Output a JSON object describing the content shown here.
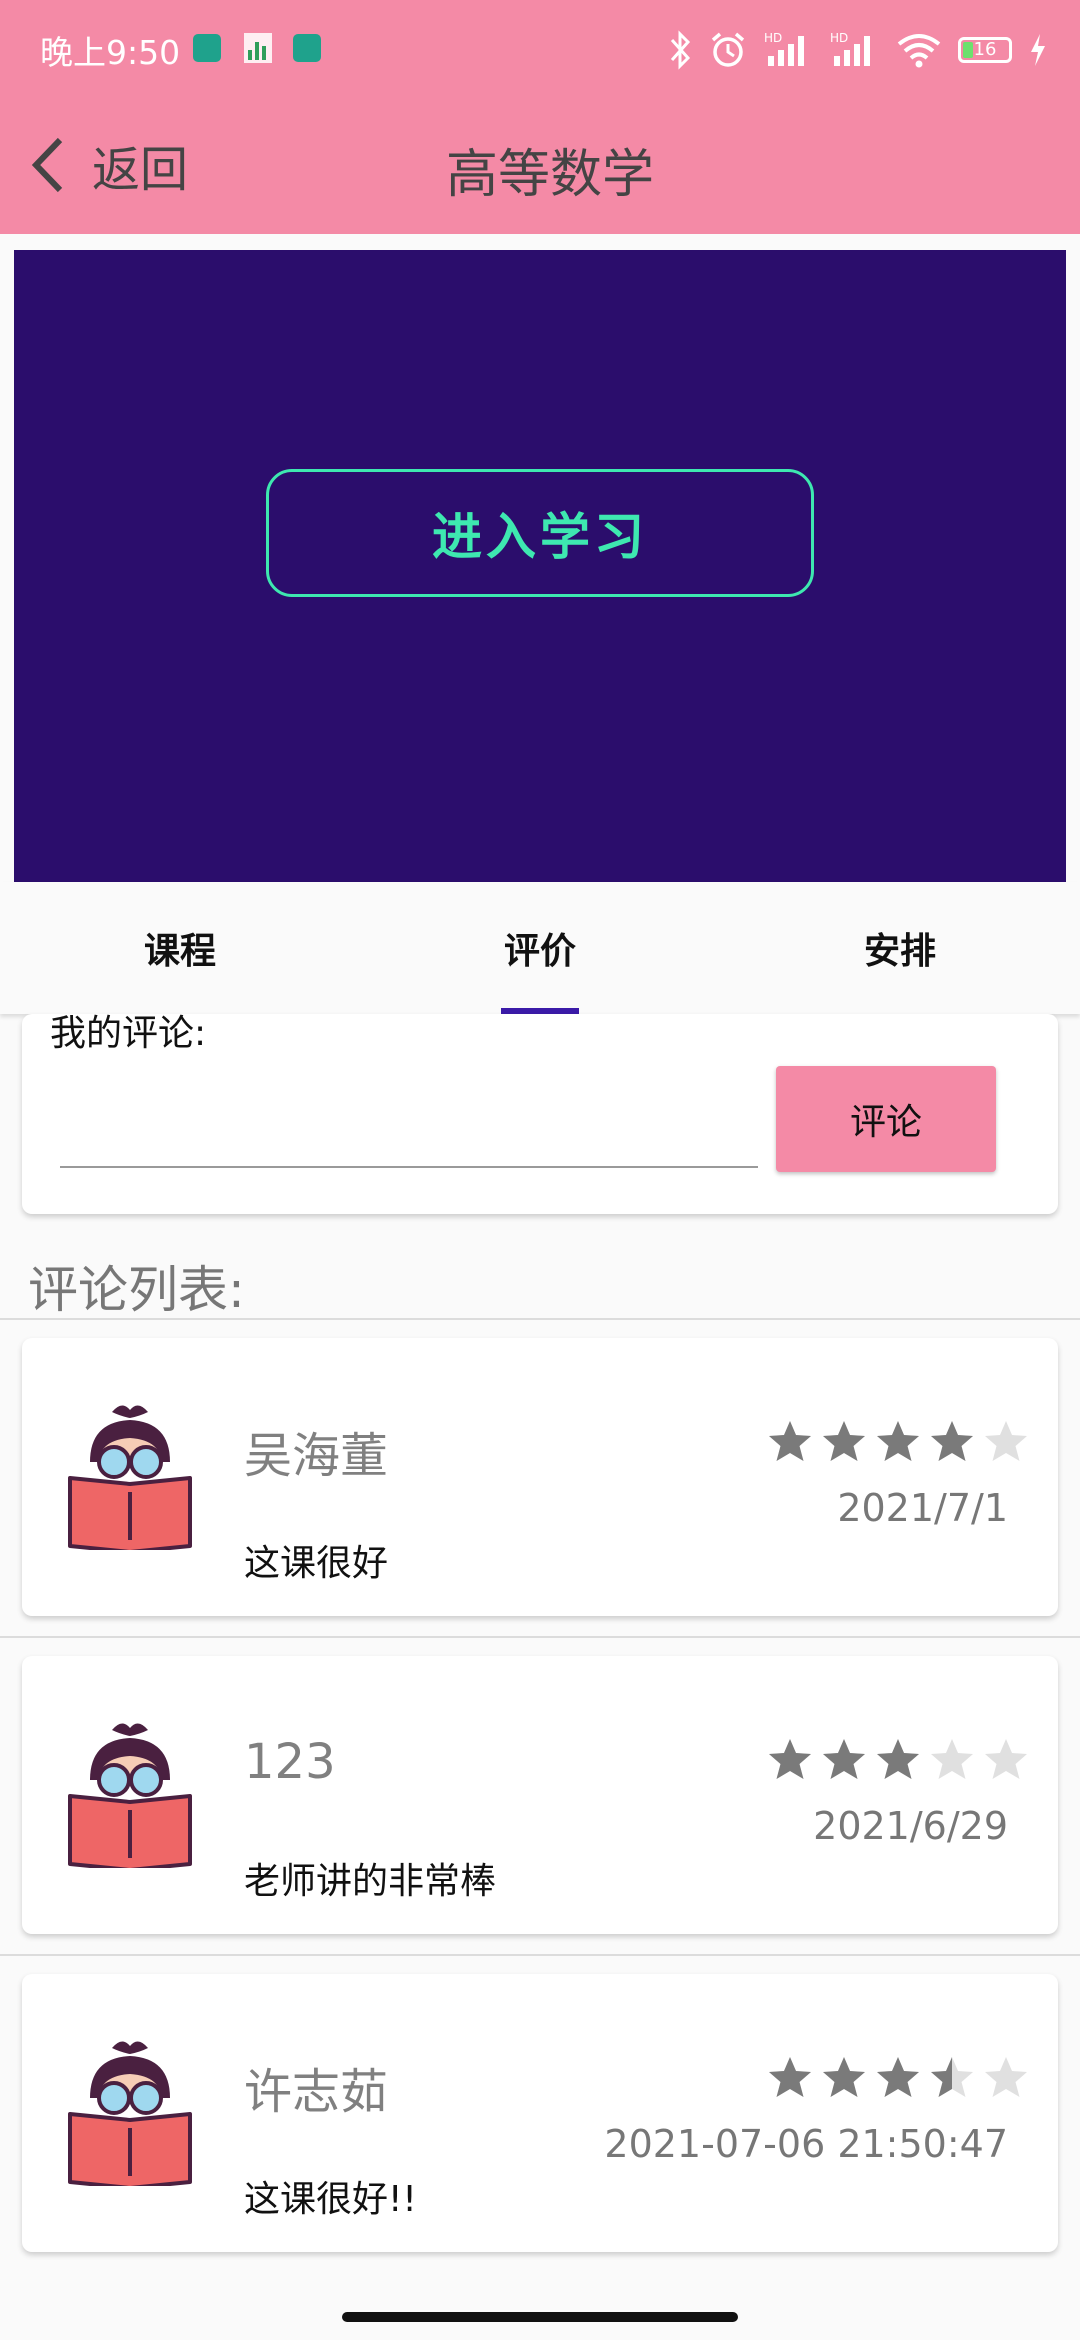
{
  "status_bar": {
    "time": "晚上9:50",
    "battery": "16",
    "icons": [
      "app-icon",
      "chart-icon",
      "app-icon",
      "bluetooth-icon",
      "alarm-icon",
      "signal-hd-icon",
      "signal-hd-icon",
      "wifi-icon",
      "battery-icon",
      "charging-icon"
    ]
  },
  "header": {
    "back_label": "返回",
    "title": "高等数学"
  },
  "banner": {
    "enter_label": "进入学习"
  },
  "tabs": [
    {
      "label": "课程",
      "selected": false
    },
    {
      "label": "评价",
      "selected": true
    },
    {
      "label": "安排",
      "selected": false
    }
  ],
  "comment_form": {
    "label": "我的评论:",
    "input_value": "",
    "button_label": "评论"
  },
  "list_title": "评论列表:",
  "reviews": [
    {
      "name": "吴海董",
      "text": "这课很好",
      "date": "2021/7/1",
      "rating": 4,
      "max_rating": 5
    },
    {
      "name": "123",
      "text": "老师讲的非常棒",
      "date": "2021/6/29",
      "rating": 3,
      "max_rating": 5
    },
    {
      "name": "许志茹",
      "text": "这课很好!!",
      "date": "2021-07-06 21:50:47",
      "rating": 3.5,
      "max_rating": 5
    }
  ],
  "colors": {
    "accent": "#f48aa6",
    "banner_bg": "#2b0d6c",
    "enter_button": "#3ee8b0",
    "tab_indicator": "#3b1aa8",
    "star_filled": "#7a7a7a",
    "star_empty": "#e0e0e0"
  }
}
